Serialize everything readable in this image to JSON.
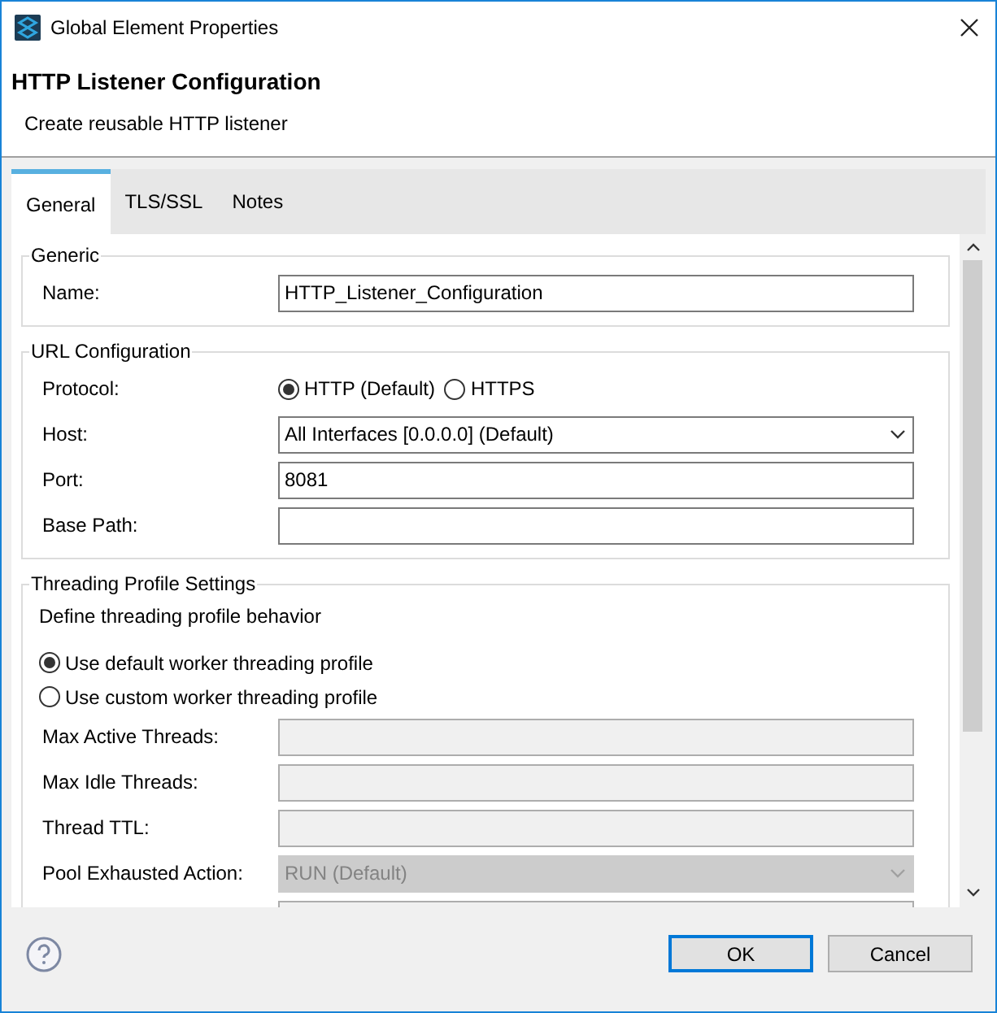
{
  "window": {
    "title": "Global Element Properties"
  },
  "header": {
    "title": "HTTP Listener Configuration",
    "subtitle": "Create reusable HTTP listener"
  },
  "tabs": [
    {
      "label": "General",
      "selected": true
    },
    {
      "label": "TLS/SSL",
      "selected": false
    },
    {
      "label": "Notes",
      "selected": false
    }
  ],
  "sections": [
    {
      "legend": "Generic",
      "rows": [
        {
          "kind": "text",
          "label": "Name:",
          "value": "HTTP_Listener_Configuration",
          "disabled": false
        }
      ]
    },
    {
      "legend": "URL Configuration",
      "rows": [
        {
          "kind": "radio_group",
          "label": "Protocol:",
          "options": [
            {
              "label": "HTTP (Default)",
              "selected": true
            },
            {
              "label": "HTTPS",
              "selected": false
            }
          ]
        },
        {
          "kind": "select",
          "label": "Host:",
          "value": "All Interfaces [0.0.0.0] (Default)",
          "disabled": false
        },
        {
          "kind": "text",
          "label": "Port:",
          "value": "8081",
          "disabled": false
        },
        {
          "kind": "text",
          "label": "Base Path:",
          "disabled": false
        }
      ]
    },
    {
      "legend": "Threading Profile Settings",
      "rows": [
        {
          "kind": "note",
          "text": "Define threading profile behavior"
        },
        {
          "kind": "radio",
          "label": "Use default worker threading profile",
          "selected": true
        },
        {
          "kind": "radio",
          "label": "Use custom worker threading profile",
          "selected": false
        },
        {
          "kind": "text",
          "label": "Max Active Threads:",
          "disabled": true
        },
        {
          "kind": "text",
          "label": "Max Idle Threads:",
          "disabled": true
        },
        {
          "kind": "text",
          "label": "Thread TTL:",
          "disabled": true
        },
        {
          "kind": "select",
          "label": "Pool Exhausted Action:",
          "value": "RUN (Default)",
          "disabled": true
        },
        {
          "kind": "text",
          "disabled": true
        }
      ]
    }
  ],
  "buttons": [
    {
      "label": "OK",
      "default": true
    },
    {
      "label": "Cancel",
      "default": false
    }
  ]
}
